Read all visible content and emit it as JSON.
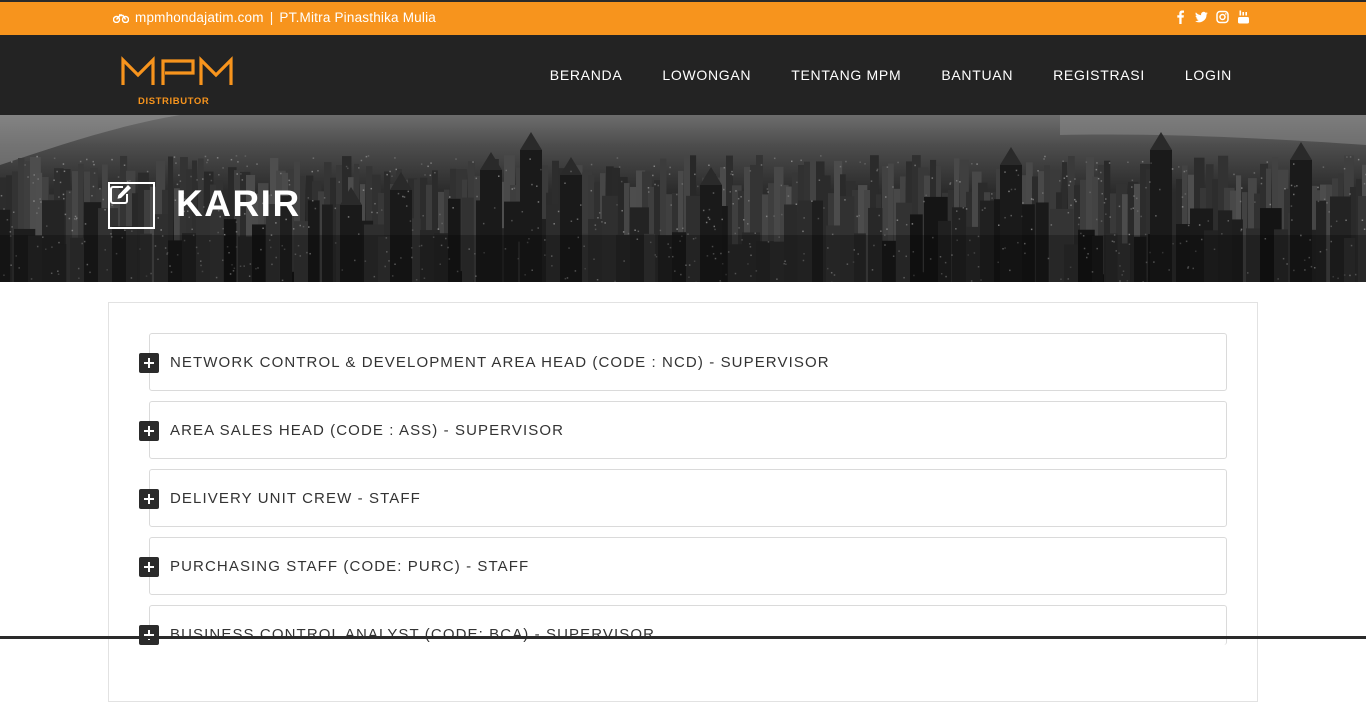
{
  "topbar": {
    "site": "mpmhondajatim.com",
    "separator": "|",
    "company": "PT.Mitra Pinasthika Mulia",
    "social": [
      "facebook-icon",
      "twitter-icon",
      "instagram-icon",
      "youtube-icon"
    ]
  },
  "brand": {
    "logo_text": "MPM",
    "logo_sub": "DISTRIBUTOR",
    "accent": "#f7941d",
    "nav_bg": "#232323"
  },
  "nav": {
    "items": [
      {
        "label": "BERANDA"
      },
      {
        "label": "LOWONGAN"
      },
      {
        "label": "TENTANG MPM"
      },
      {
        "label": "BANTUAN"
      },
      {
        "label": "REGISTRASI"
      },
      {
        "label": "LOGIN"
      }
    ]
  },
  "banner": {
    "title": "KARIR",
    "icon": "edit-icon"
  },
  "jobs": [
    {
      "title": "NETWORK CONTROL & DEVELOPMENT AREA HEAD (CODE : NCD) -  SUPERVISOR"
    },
    {
      "title": "AREA SALES HEAD (CODE : ASS) -  SUPERVISOR"
    },
    {
      "title": "DELIVERY UNIT CREW -  STAFF"
    },
    {
      "title": "PURCHASING STAFF (CODE: PURC) -  STAFF"
    },
    {
      "title": "BUSINESS CONTROL ANALYST (CODE: BCA) -  SUPERVISOR"
    }
  ]
}
